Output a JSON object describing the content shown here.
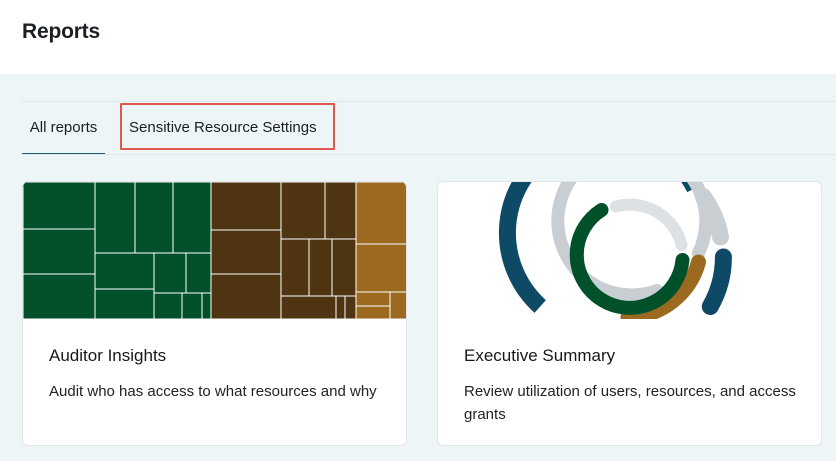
{
  "header": {
    "title": "Reports"
  },
  "tabs": [
    {
      "label": "All reports",
      "active": true
    },
    {
      "label": "Sensitive Resource Settings",
      "active": false,
      "highlighted": true
    }
  ],
  "cards": [
    {
      "title": "Auditor Insights",
      "description": "Audit who has access to what resources and why",
      "illustration": "treemap"
    },
    {
      "title": "Executive Summary",
      "description": "Review utilization of users, resources, and access grants",
      "illustration": "concentric-rings"
    }
  ],
  "colors": {
    "accent": "#1f5c73",
    "highlight_border": "#e0584b",
    "green": "#00502a",
    "brown": "#4f3411",
    "gold": "#9b6a20",
    "navy": "#0e4a66",
    "gray": "#c9ced2"
  }
}
